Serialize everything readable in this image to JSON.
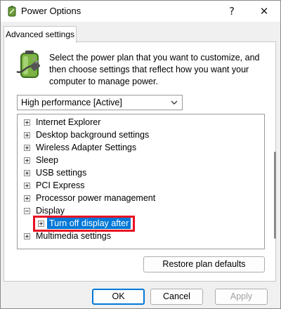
{
  "window": {
    "title": "Power Options",
    "help_label": "?",
    "close_label": "✕"
  },
  "tab": {
    "label": "Advanced settings"
  },
  "intro_text": "Select the power plan that you want to customize, and then choose settings that reflect how you want your computer to manage power.",
  "plan_select": {
    "value": "High performance [Active]"
  },
  "tree": {
    "items": [
      {
        "label": "Internet Explorer",
        "expander": "+"
      },
      {
        "label": "Desktop background settings",
        "expander": "+"
      },
      {
        "label": "Wireless Adapter Settings",
        "expander": "+"
      },
      {
        "label": "Sleep",
        "expander": "+"
      },
      {
        "label": "USB settings",
        "expander": "+"
      },
      {
        "label": "PCI Express",
        "expander": "+"
      },
      {
        "label": "Processor power management",
        "expander": "+"
      },
      {
        "label": "Display",
        "expander": "-"
      },
      {
        "label": "Turn off display after",
        "expander": "+",
        "selected": true
      },
      {
        "label": "Multimedia settings",
        "expander": "+"
      }
    ]
  },
  "buttons": {
    "restore": "Restore plan defaults",
    "ok": "OK",
    "cancel": "Cancel",
    "apply": "Apply"
  },
  "colors": {
    "selection": "#0078d7",
    "highlight_border": "#e81123"
  },
  "icons": {
    "app": "battery-power-icon",
    "plan": "battery-plug-icon"
  }
}
